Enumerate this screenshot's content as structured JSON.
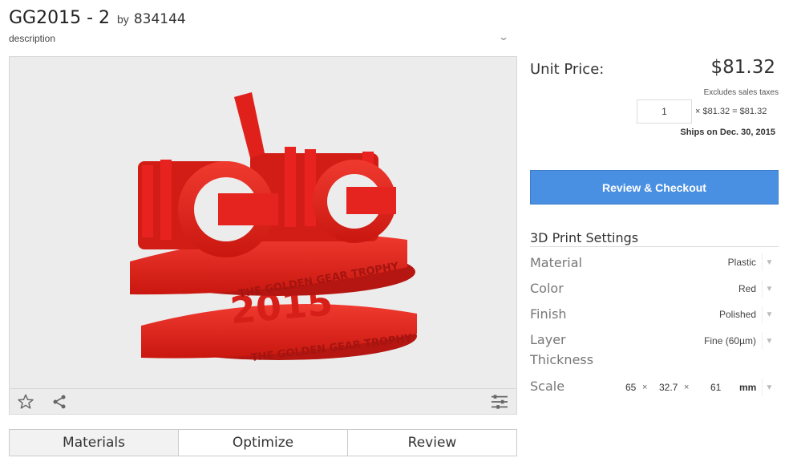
{
  "header": {
    "title": "GG2015 - 2",
    "by": "by",
    "author": "834144",
    "description_label": "description"
  },
  "model": {
    "number": "1",
    "year": "2015",
    "ring_text": "THE GOLDEN GEAR TROPHY",
    "color": "#e8231f"
  },
  "tabs": [
    "Materials",
    "Optimize",
    "Review"
  ],
  "pricing": {
    "unit_price_label": "Unit Price:",
    "unit_price": "$81.32",
    "tax_note": "Excludes sales taxes",
    "quantity": "1",
    "formula": "× $81.32 = $81.32",
    "ships": "Ships on Dec. 30, 2015"
  },
  "checkout_label": "Review & Checkout",
  "settings": {
    "title": "3D Print Settings",
    "material_label": "Material",
    "material_value": "Plastic",
    "color_label": "Color",
    "color_value": "Red",
    "finish_label": "Finish",
    "finish_value": "Polished",
    "layer_label_1": "Layer",
    "layer_label_2": "Thickness",
    "layer_value": "Fine (60µm)",
    "scale_label": "Scale",
    "scale_x": "65",
    "scale_y": "32.7",
    "scale_z": "61",
    "times": "×",
    "unit": "mm"
  },
  "colors": {
    "accent": "#4a90e2",
    "model_red": "#e8231f"
  }
}
